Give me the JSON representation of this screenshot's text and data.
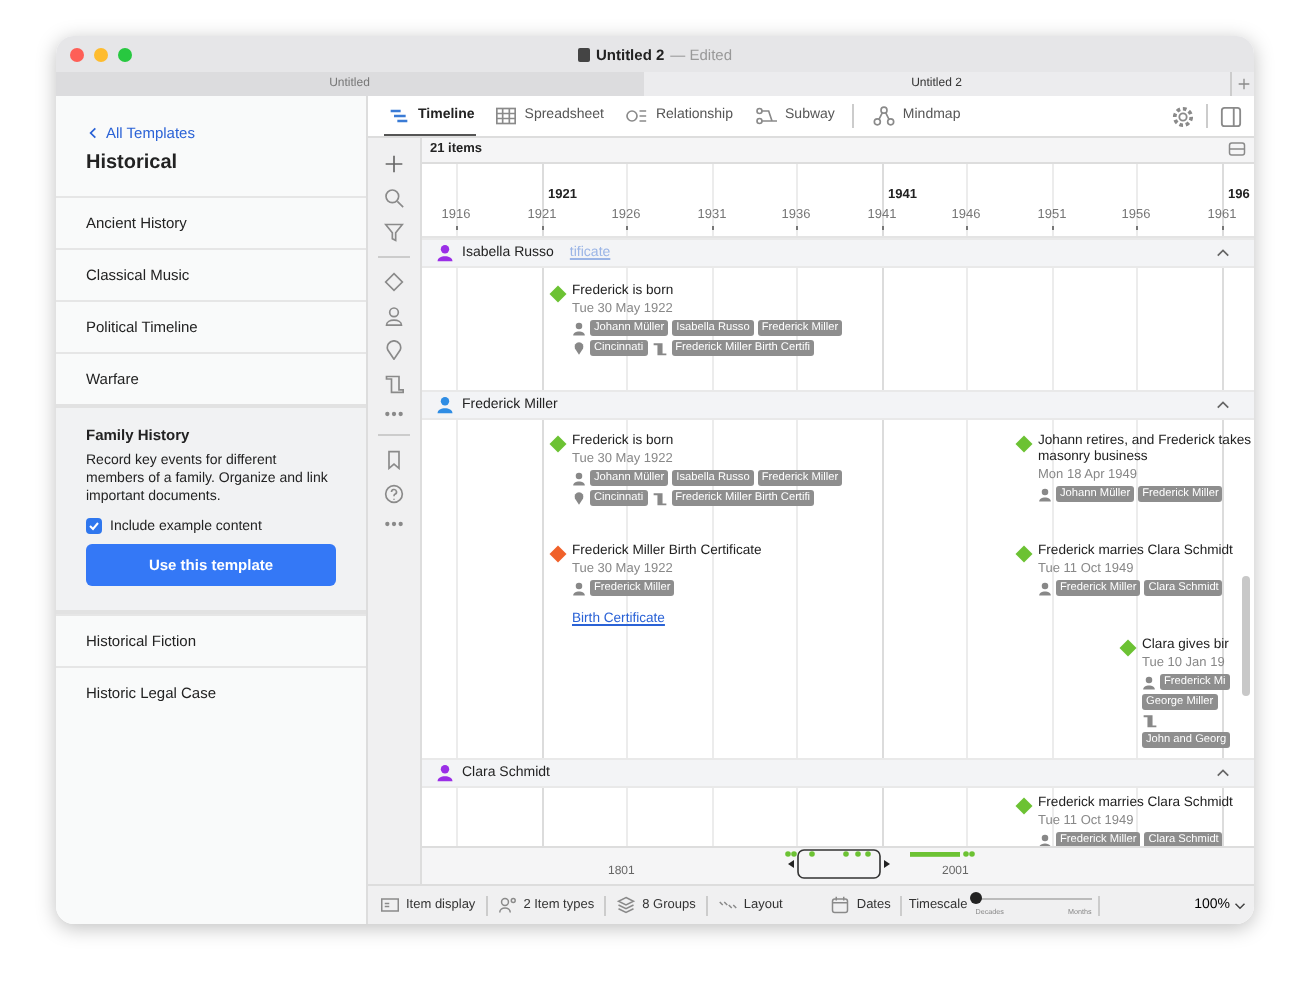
{
  "window": {
    "title": "Untitled 2",
    "status": "— Edited"
  },
  "tabs": [
    {
      "label": "Untitled",
      "selected": false
    },
    {
      "label": "Untitled 2",
      "selected": true
    }
  ],
  "sidebar": {
    "back_link": "All Templates",
    "heading": "Historical",
    "templates": [
      {
        "name": "Ancient History",
        "selected": false
      },
      {
        "name": "Classical Music",
        "selected": false
      },
      {
        "name": "Political Timeline",
        "selected": false
      },
      {
        "name": "Warfare",
        "selected": false
      },
      {
        "name": "Family History",
        "selected": true,
        "description": "Record key events for different members of a family. Organize and link important documents.",
        "option": {
          "label": "Include example content",
          "checked": true
        },
        "button": "Use this template"
      },
      {
        "name": "Historical Fiction",
        "selected": false
      },
      {
        "name": "Historic Legal Case",
        "selected": false
      }
    ]
  },
  "views": [
    {
      "label": "Timeline",
      "selected": true
    },
    {
      "label": "Spreadsheet",
      "selected": false
    },
    {
      "label": "Relationship",
      "selected": false
    },
    {
      "label": "Subway",
      "selected": false
    },
    {
      "label": "Mindmap",
      "selected": false
    }
  ],
  "item_count": "21 items",
  "axis": {
    "major": [
      "1921",
      "1941",
      "196"
    ],
    "minor": [
      "1916",
      "1921",
      "1926",
      "1931",
      "1936",
      "1941",
      "1946",
      "1951",
      "1956",
      "1961"
    ]
  },
  "groups": [
    {
      "name": "Isabella Russo",
      "color": "#9a2ee6",
      "note": "tificate",
      "expanded": true,
      "events": [
        {
          "kind": "event",
          "title": "Frederick is born",
          "date": "Tue 30 May 1922",
          "tag_rows": [
            [
              {
                "kind": "person",
                "labels": [
                  "Johann Müller",
                  "Isabella Russo",
                  "Frederick Miller"
                ]
              }
            ],
            [
              {
                "kind": "place",
                "labels": [
                  "Cincinnati"
                ]
              },
              {
                "kind": "document",
                "labels": [
                  "Frederick Miller Birth Certifi"
                ]
              }
            ]
          ]
        }
      ]
    },
    {
      "name": "Frederick Miller",
      "color": "#2f8de4",
      "expanded": true,
      "events": [
        {
          "kind": "event",
          "title": "Frederick is born",
          "date": "Tue 30 May 1922",
          "tag_rows": [
            [
              {
                "kind": "person",
                "labels": [
                  "Johann Müller",
                  "Isabella Russo",
                  "Frederick Miller"
                ]
              }
            ],
            [
              {
                "kind": "place",
                "labels": [
                  "Cincinnati"
                ]
              },
              {
                "kind": "document",
                "labels": [
                  "Frederick Miller Birth Certifi"
                ]
              }
            ]
          ]
        },
        {
          "kind": "event",
          "title": "Johann retires, and Frederick takes masonry business",
          "date": "Mon 18 Apr 1949",
          "tag_rows": [
            [
              {
                "kind": "person",
                "labels": [
                  "Johann Müller",
                  "Frederick Miller"
                ]
              }
            ]
          ]
        },
        {
          "kind": "document",
          "title": "Frederick Miller Birth Certificate",
          "date": "Tue 30 May 1922",
          "tag_rows": [
            [
              {
                "kind": "person",
                "labels": [
                  "Frederick Miller"
                ]
              }
            ]
          ],
          "link": "Birth Certificate"
        },
        {
          "kind": "event",
          "title": "Frederick marries Clara Schmidt",
          "date": "Tue 11 Oct 1949",
          "tag_rows": [
            [
              {
                "kind": "person",
                "labels": [
                  "Frederick Miller",
                  "Clara Schmidt"
                ]
              }
            ]
          ]
        },
        {
          "kind": "event",
          "title": "Clara gives bir",
          "date": "Tue 10 Jan 19",
          "tag_rows": [
            [
              {
                "kind": "person",
                "labels": [
                  "Frederick Mi",
                  "George Miller"
                ]
              }
            ],
            [
              {
                "kind": "document",
                "labels": [
                  "John and Georg"
                ]
              }
            ]
          ]
        }
      ]
    },
    {
      "name": "Clara Schmidt",
      "color": "#9a2ee6",
      "expanded": true,
      "events": [
        {
          "kind": "event",
          "title": "Frederick marries Clara Schmidt",
          "date": "Tue 11 Oct 1949",
          "tag_rows": [
            [
              {
                "kind": "person",
                "labels": [
                  "Frederick Miller",
                  "Clara Schmidt"
                ]
              }
            ]
          ]
        }
      ]
    }
  ],
  "overview": {
    "labels": [
      "1801",
      "2001"
    ]
  },
  "status_bar": {
    "items": [
      {
        "label": "Item display"
      },
      {
        "label": "2 Item types"
      },
      {
        "label": "8 Groups"
      },
      {
        "label": "Layout"
      },
      {
        "label": "Dates"
      }
    ],
    "timescale": {
      "label": "Timescale",
      "level": 0,
      "min_label": "Decades",
      "max_label": "Months"
    },
    "zoom": "100%"
  }
}
